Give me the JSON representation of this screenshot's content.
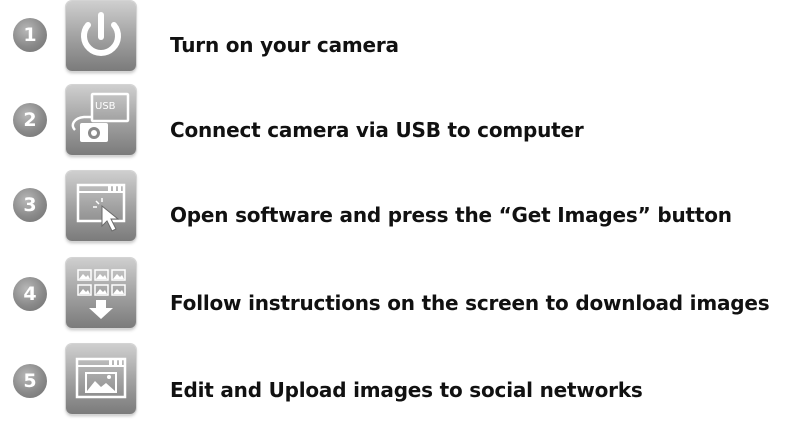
{
  "steps": [
    {
      "number": "1",
      "icon": "power-icon",
      "text": "Turn on your camera"
    },
    {
      "number": "2",
      "icon": "usb-camera-computer-icon",
      "icon_label": "USB",
      "text": "Connect camera via USB to computer"
    },
    {
      "number": "3",
      "icon": "software-window-cursor-icon",
      "text": "Open software and press the “Get Images” button"
    },
    {
      "number": "4",
      "icon": "download-images-icon",
      "text": "Follow instructions on the screen to download images"
    },
    {
      "number": "5",
      "icon": "upload-image-window-icon",
      "text": "Edit and Upload images to social networks"
    }
  ],
  "colors": {
    "icon_gradient_top": "#c9c9c9",
    "icon_gradient_bottom": "#7e7e7e",
    "badge": "#8a8a8a",
    "text": "#111111"
  }
}
